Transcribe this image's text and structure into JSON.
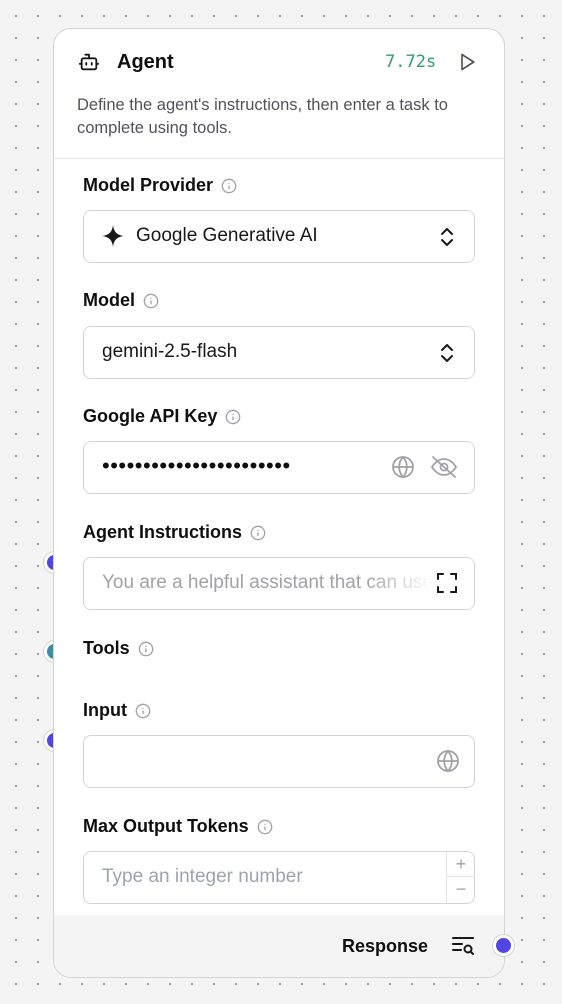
{
  "node": {
    "title": "Agent",
    "timer": "7.72s",
    "description": "Define the agent's instructions, then enter a task to complete using tools.",
    "icon": "bot-icon"
  },
  "fields": {
    "model_provider": {
      "label": "Model Provider",
      "value": "Google Generative AI",
      "icon": "sparkle-icon"
    },
    "model": {
      "label": "Model",
      "value": "gemini-2.5-flash"
    },
    "api_key": {
      "label": "Google API Key",
      "masked_value": "•••••••••••••••••••••••"
    },
    "agent_instructions": {
      "label": "Agent Instructions",
      "placeholder": "You are a helpful assistant that can use tools to answer questions and perform tasks."
    },
    "tools": {
      "label": "Tools"
    },
    "input": {
      "label": "Input",
      "value": ""
    },
    "max_output_tokens": {
      "label": "Max Output Tokens",
      "placeholder": "Type an integer number",
      "increment": "+",
      "decrement": "−"
    }
  },
  "footer": {
    "output_label": "Response"
  },
  "colors": {
    "handle_primary": "#4f46e5",
    "handle_tools": "#3b8ea5",
    "timer": "#2f9e6e"
  }
}
